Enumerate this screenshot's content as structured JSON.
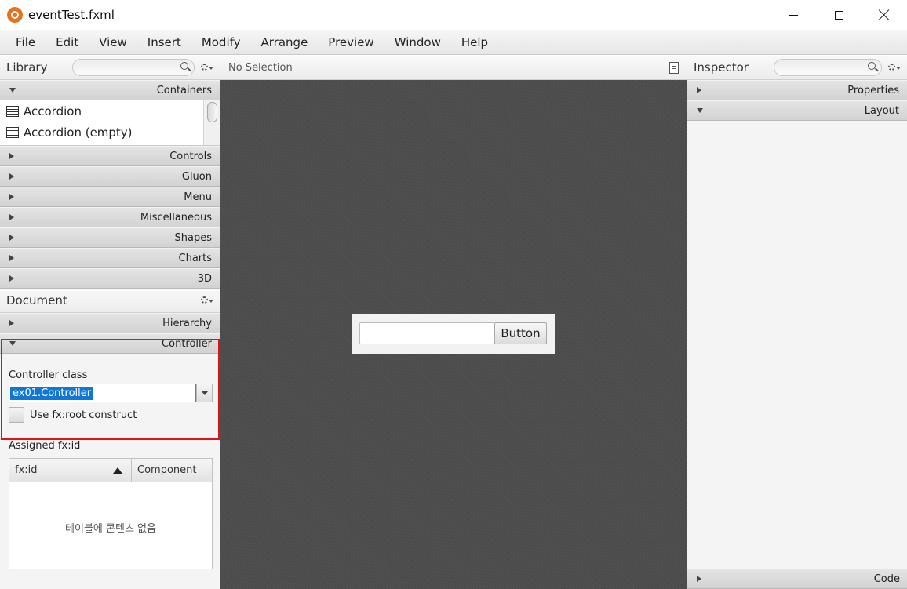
{
  "window": {
    "title": "eventTest.fxml"
  },
  "menu": [
    "File",
    "Edit",
    "View",
    "Insert",
    "Modify",
    "Arrange",
    "Preview",
    "Window",
    "Help"
  ],
  "library": {
    "title": "Library",
    "open_section": "Containers",
    "items": [
      "Accordion",
      "Accordion  (empty)"
    ],
    "sections": [
      "Controls",
      "Gluon",
      "Menu",
      "Miscellaneous",
      "Shapes",
      "Charts",
      "3D"
    ]
  },
  "document": {
    "title": "Document",
    "hierarchy_label": "Hierarchy",
    "controller_label": "Controller",
    "controller_class_label": "Controller class",
    "controller_class_value": "ex01.Controller",
    "use_root_label": "Use fx:root construct",
    "assigned_label": "Assigned fx:id",
    "table": {
      "col_fxid": "fx:id",
      "col_component": "Component",
      "empty_text": "테이블에 콘텐츠 없음"
    }
  },
  "center": {
    "title": "No Selection",
    "button_label": "Button"
  },
  "inspector": {
    "title": "Inspector",
    "properties_label": "Properties",
    "layout_label": "Layout",
    "code_label": "Code"
  }
}
